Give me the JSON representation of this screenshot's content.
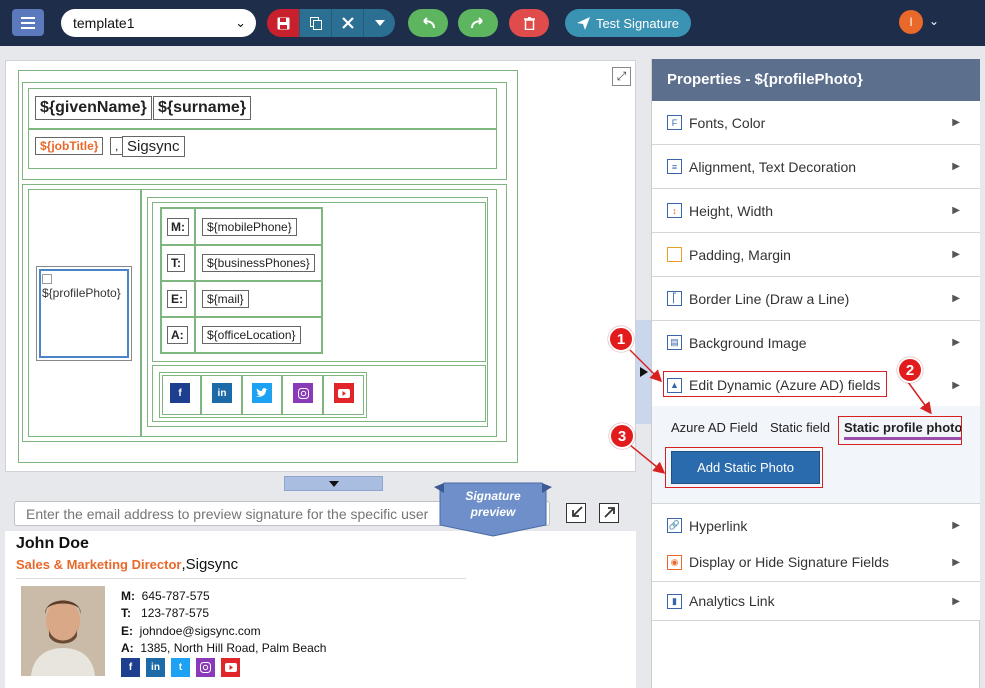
{
  "topbar": {
    "template_name": "template1",
    "test_signature_label": "Test Signature",
    "user_initial": "I"
  },
  "editor": {
    "given_name": "${givenName}",
    "surname": "${surname}",
    "job_title": "${jobTitle}",
    "separator": ",",
    "company": "Sigsync",
    "profile_photo": "${profilePhoto}",
    "labels": [
      "M:",
      "T:",
      "E:",
      "A:"
    ],
    "fields": [
      "${mobilePhone}",
      "${businessPhones}",
      "${mail}",
      "${officeLocation}"
    ],
    "social": [
      "f",
      "in",
      "t",
      "ig",
      "yt"
    ]
  },
  "preview": {
    "email_placeholder": "Enter the email address to preview signature for the specific user",
    "signature_preview_label_1": "Signature",
    "signature_preview_label_2": "preview",
    "name": "John Doe",
    "job_title": "Sales & Marketing Director",
    "company": ",Sigsync",
    "labels": [
      "M:",
      "T:",
      "E:",
      "A:"
    ],
    "values": [
      "645-787-575",
      "123-787-575",
      "johndoe@sigsync.com",
      "1385, North Hill Road, Palm Beach"
    ]
  },
  "properties": {
    "title": "Properties - ${profilePhoto}",
    "items": [
      {
        "label": "Fonts, Color",
        "icon": "font-icon"
      },
      {
        "label": "Alignment, Text Decoration",
        "icon": "align-icon"
      },
      {
        "label": "Height, Width",
        "icon": "height-icon"
      },
      {
        "label": "Padding, Margin",
        "icon": "padding-icon"
      },
      {
        "label": "Border Line (Draw a Line)",
        "icon": "border-icon"
      },
      {
        "label": "Background Image",
        "icon": "image-icon"
      },
      {
        "label": "Edit Dynamic (Azure AD) fields",
        "icon": "dynamic-icon"
      },
      {
        "label": "Hyperlink",
        "icon": "link-icon"
      },
      {
        "label": "Display or Hide Signature Fields",
        "icon": "eye-icon"
      },
      {
        "label": "Analytics Link",
        "icon": "analytics-icon"
      }
    ],
    "subtabs": [
      "Azure AD Field",
      "Static field",
      "Static profile photo"
    ],
    "add_photo_label": "Add Static Photo"
  },
  "annotations": [
    "1",
    "2",
    "3"
  ],
  "colors": {
    "accent": "#2a6bad",
    "topbar": "#1e2d4a",
    "annotation": "#e21c1c",
    "job_title": "#e8692a"
  }
}
